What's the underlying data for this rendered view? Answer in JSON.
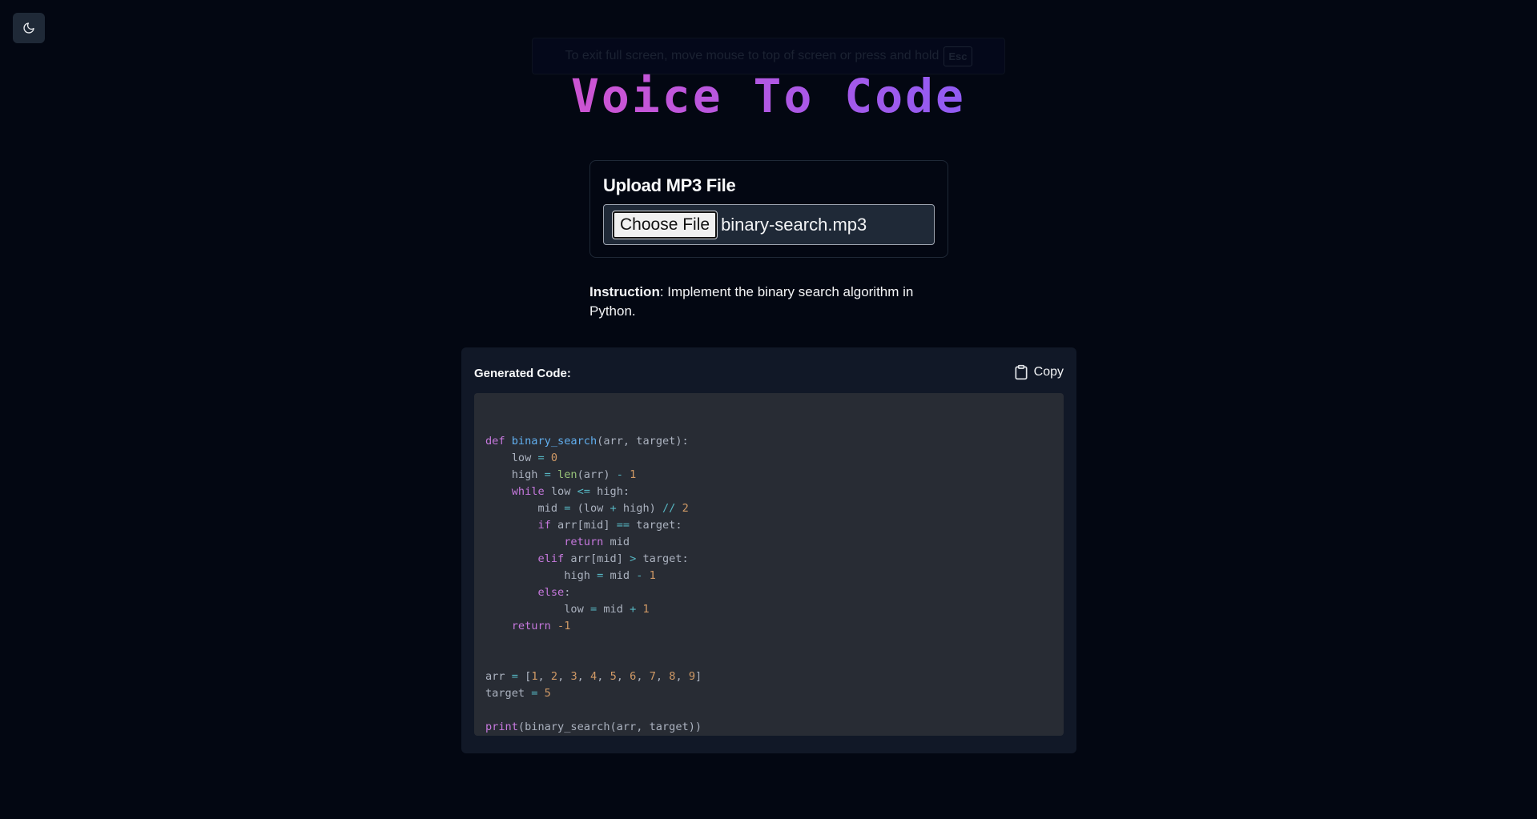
{
  "app": {
    "title": "Voice To Code",
    "theme_toggle_icon": "moon-icon"
  },
  "fullscreen_notice": {
    "text": "To exit full screen, move mouse to top of screen or press and hold",
    "key": "Esc"
  },
  "upload": {
    "heading": "Upload MP3 File",
    "button_label": "Choose File",
    "file_name": "binary-search.mp3"
  },
  "instruction": {
    "label": "Instruction",
    "text": ": Implement the binary search algorithm in Python."
  },
  "code_panel": {
    "heading": "Generated Code:",
    "copy_label": "Copy",
    "copy_icon": "clipboard-icon",
    "language": "python",
    "lines": [
      "",
      "def binary_search(arr, target):",
      "    low = 0",
      "    high = len(arr) - 1",
      "    while low <= high:",
      "        mid = (low + high) // 2",
      "        if arr[mid] == target:",
      "            return mid",
      "        elif arr[mid] > target:",
      "            high = mid - 1",
      "        else:",
      "            low = mid + 1",
      "    return -1",
      "",
      "",
      "arr = [1, 2, 3, 4, 5, 6, 7, 8, 9]",
      "target = 5",
      "",
      "print(binary_search(arr, target))"
    ]
  },
  "colors": {
    "background": "#030712",
    "title_gradient_start": "#ec4899",
    "title_gradient_end": "#3b82f6",
    "code_background": "#282c34"
  }
}
